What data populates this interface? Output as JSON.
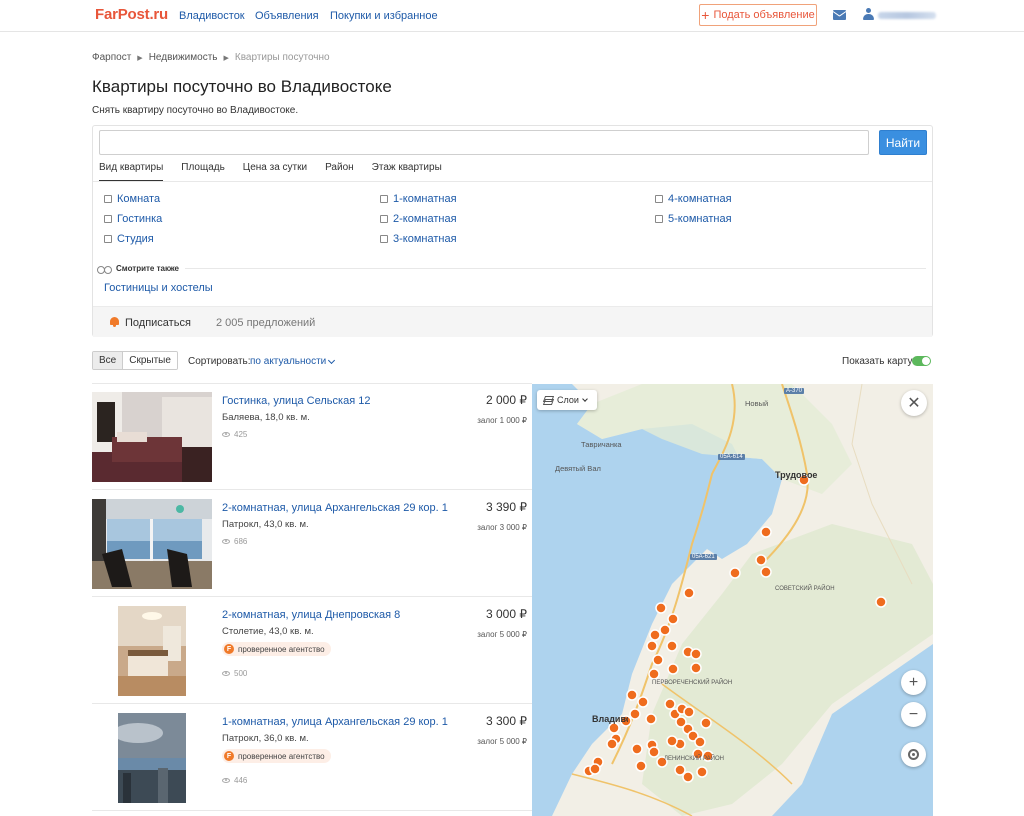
{
  "header": {
    "logo": "FarPost.ru",
    "nav": [
      "Владивосток",
      "Объявления",
      "Покупки и избранное"
    ],
    "post_button": "Подать объявление"
  },
  "breadcrumb": [
    "Фарпост",
    "Недвижимость",
    "Квартиры посуточно"
  ],
  "page": {
    "title": "Квартиры посуточно во Владивостоке",
    "subtitle": "Снять квартиру посуточно во Владивостоке."
  },
  "search": {
    "value": "",
    "placeholder": "",
    "button": "Найти"
  },
  "filter_tabs": [
    "Вид квартиры",
    "Площадь",
    "Цена за сутки",
    "Район",
    "Этаж квартиры"
  ],
  "options": {
    "col1": [
      "Комната",
      "Гостинка",
      "Студия"
    ],
    "col2": [
      "1-комнатная",
      "2-комнатная",
      "3-комнатная"
    ],
    "col3": [
      "4-комнатная",
      "5-комнатная"
    ]
  },
  "see_also": {
    "label": "Смотрите также",
    "link": "Гостиницы и хостелы"
  },
  "subscribe": {
    "label": "Подписаться",
    "offers": "2 005 предложений"
  },
  "controls": {
    "segments": [
      "Все",
      "Скрытые"
    ],
    "sort_label": "Сортировать:",
    "sort_value": "по актуальности",
    "show_map": "Показать карту"
  },
  "listings": [
    {
      "title": "Гостинка, улица Сельская 12",
      "desc": "Баляева, 18,0 кв. м.",
      "views": "425",
      "price": "2 000 ₽",
      "deposit": "залог 1 000 ₽",
      "badge": ""
    },
    {
      "title": "2-комнатная, улица Архангельская 29 кор. 1",
      "desc": "Патрокл, 43,0 кв. м.",
      "views": "686",
      "price": "3 390 ₽",
      "deposit": "залог 3 000 ₽",
      "badge": ""
    },
    {
      "title": "2-комнатная, улица Днепровская 8",
      "desc": "Столетие, 43,0 кв. м.",
      "views": "500",
      "price": "3 000 ₽",
      "deposit": "залог 5 000 ₽",
      "badge": "проверенное агентство"
    },
    {
      "title": "1-комнатная, улица Архангельская 29 кор. 1",
      "desc": "Патрокл, 36,0 кв. м.",
      "views": "446",
      "price": "3 300 ₽",
      "deposit": "залог 5 000 ₽",
      "badge": "проверенное агентство"
    }
  ],
  "map": {
    "layers": "Слои",
    "labels": [
      "Новый",
      "Тавричанка",
      "Девятый Вал",
      "Трудовое",
      "СОВЕТСКИЙ РАЙОН",
      "ПЕРВОРЕЧЕНСКИЙ РАЙОН",
      "ЛЕНИНСКИЙ РАЙОН",
      "Владивосток"
    ],
    "roads": [
      "А-370",
      "05А-614",
      "05А-621"
    ],
    "right_label": "А",
    "badge_icon": "F"
  }
}
